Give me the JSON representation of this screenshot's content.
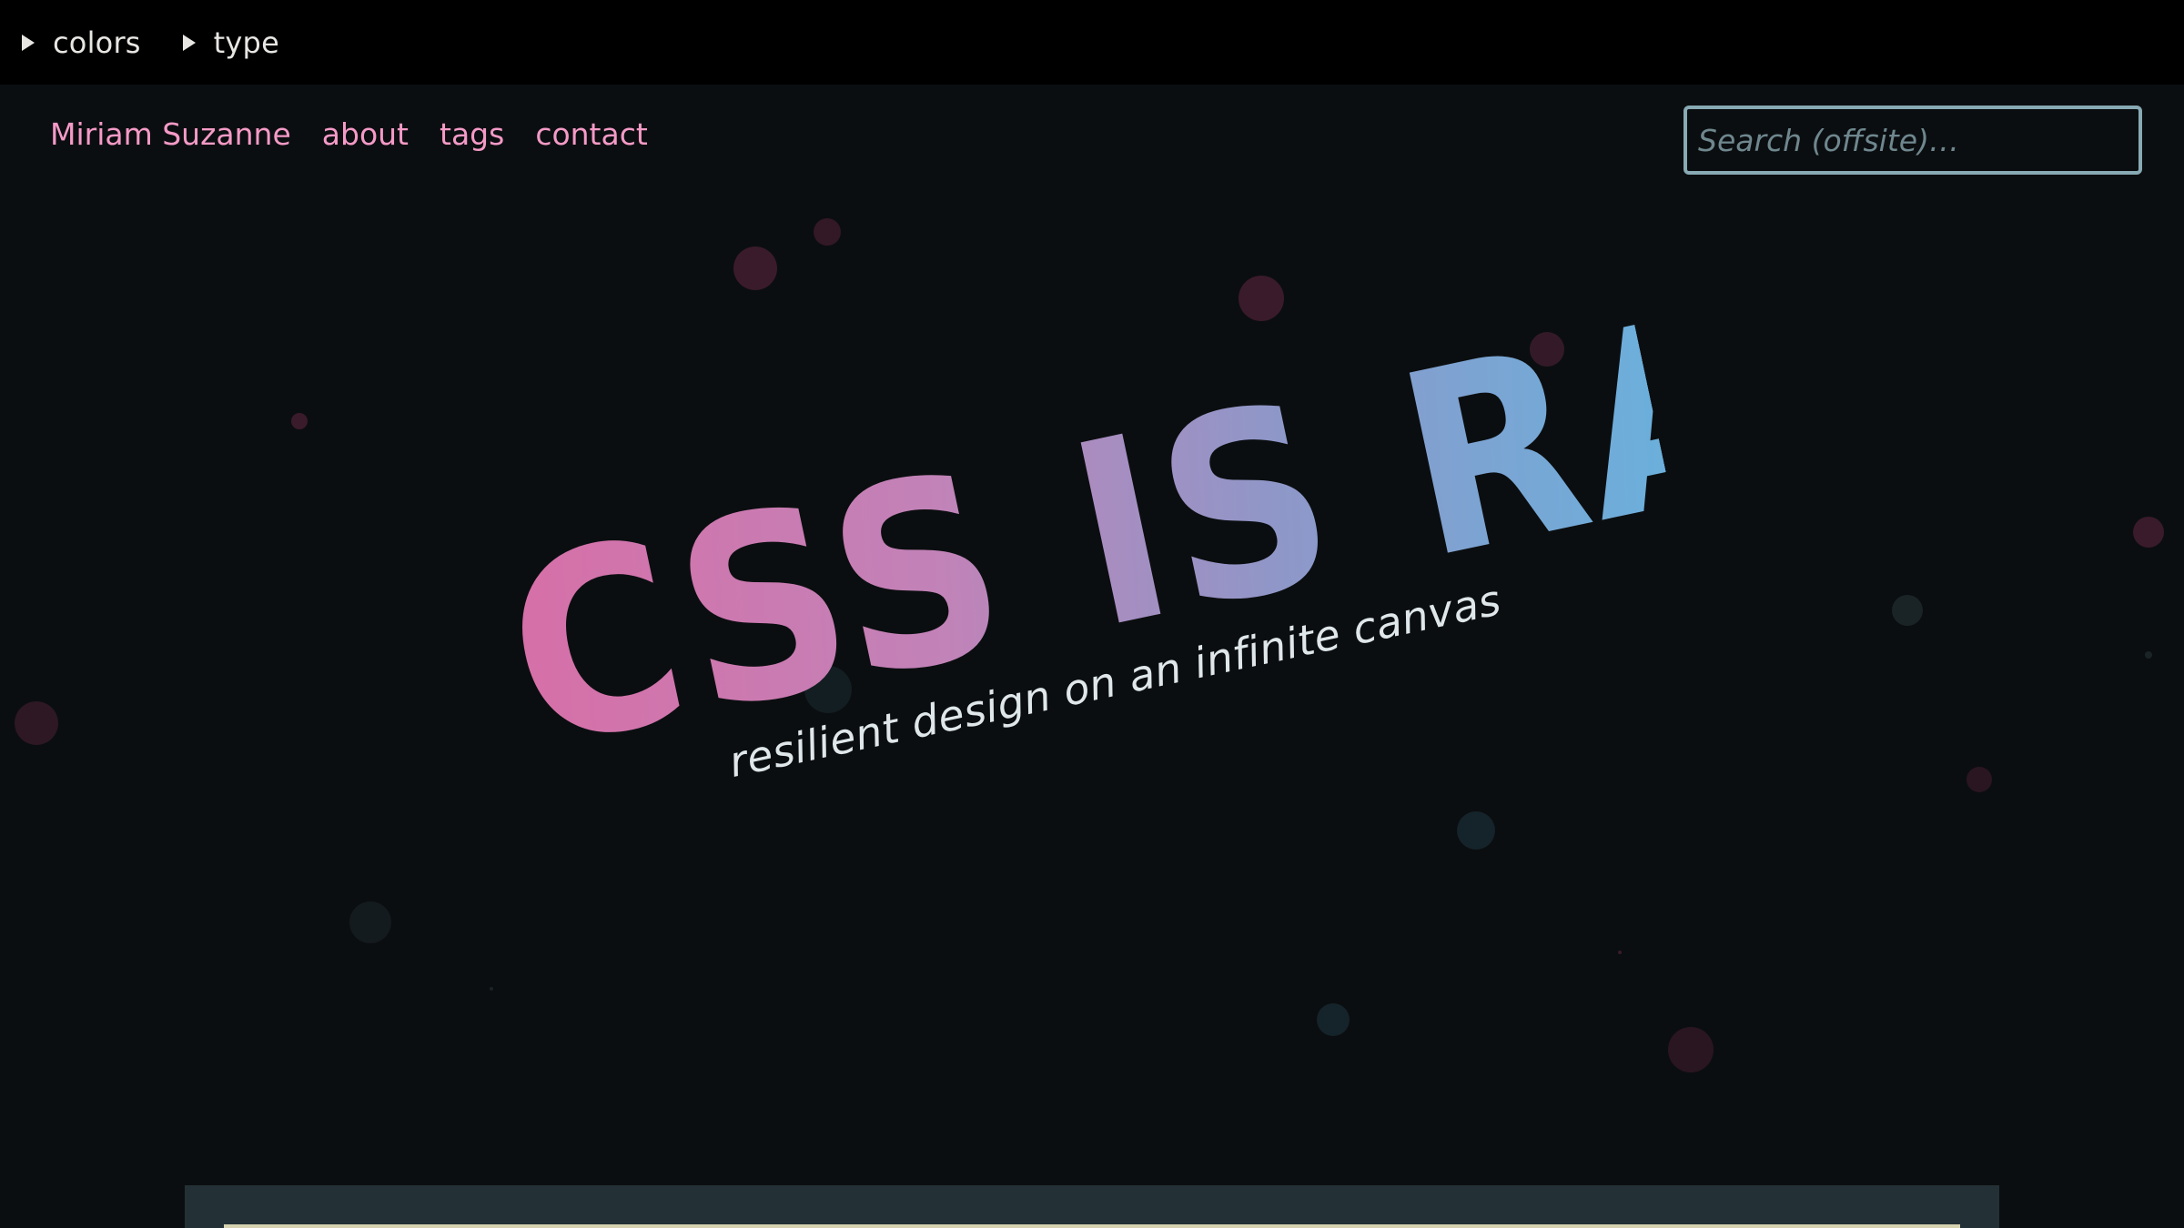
{
  "settings": {
    "colors_label": "colors",
    "type_label": "type"
  },
  "nav": {
    "site_name": "Miriam Suzanne",
    "items": [
      "about",
      "tags",
      "contact"
    ]
  },
  "search": {
    "placeholder": "Search (offsite)…",
    "value": ""
  },
  "hero": {
    "title": "CSS IS RAD",
    "subtitle": "resilient design on an infinite canvas"
  },
  "theme": {
    "background": "#0b0e10",
    "bar_background": "#000000",
    "link_color": "#f59ac7",
    "search_border": "#88aab4",
    "gradient_start": "#d86ea7",
    "gradient_end": "#6ab0dc",
    "card_background": "#233036"
  }
}
